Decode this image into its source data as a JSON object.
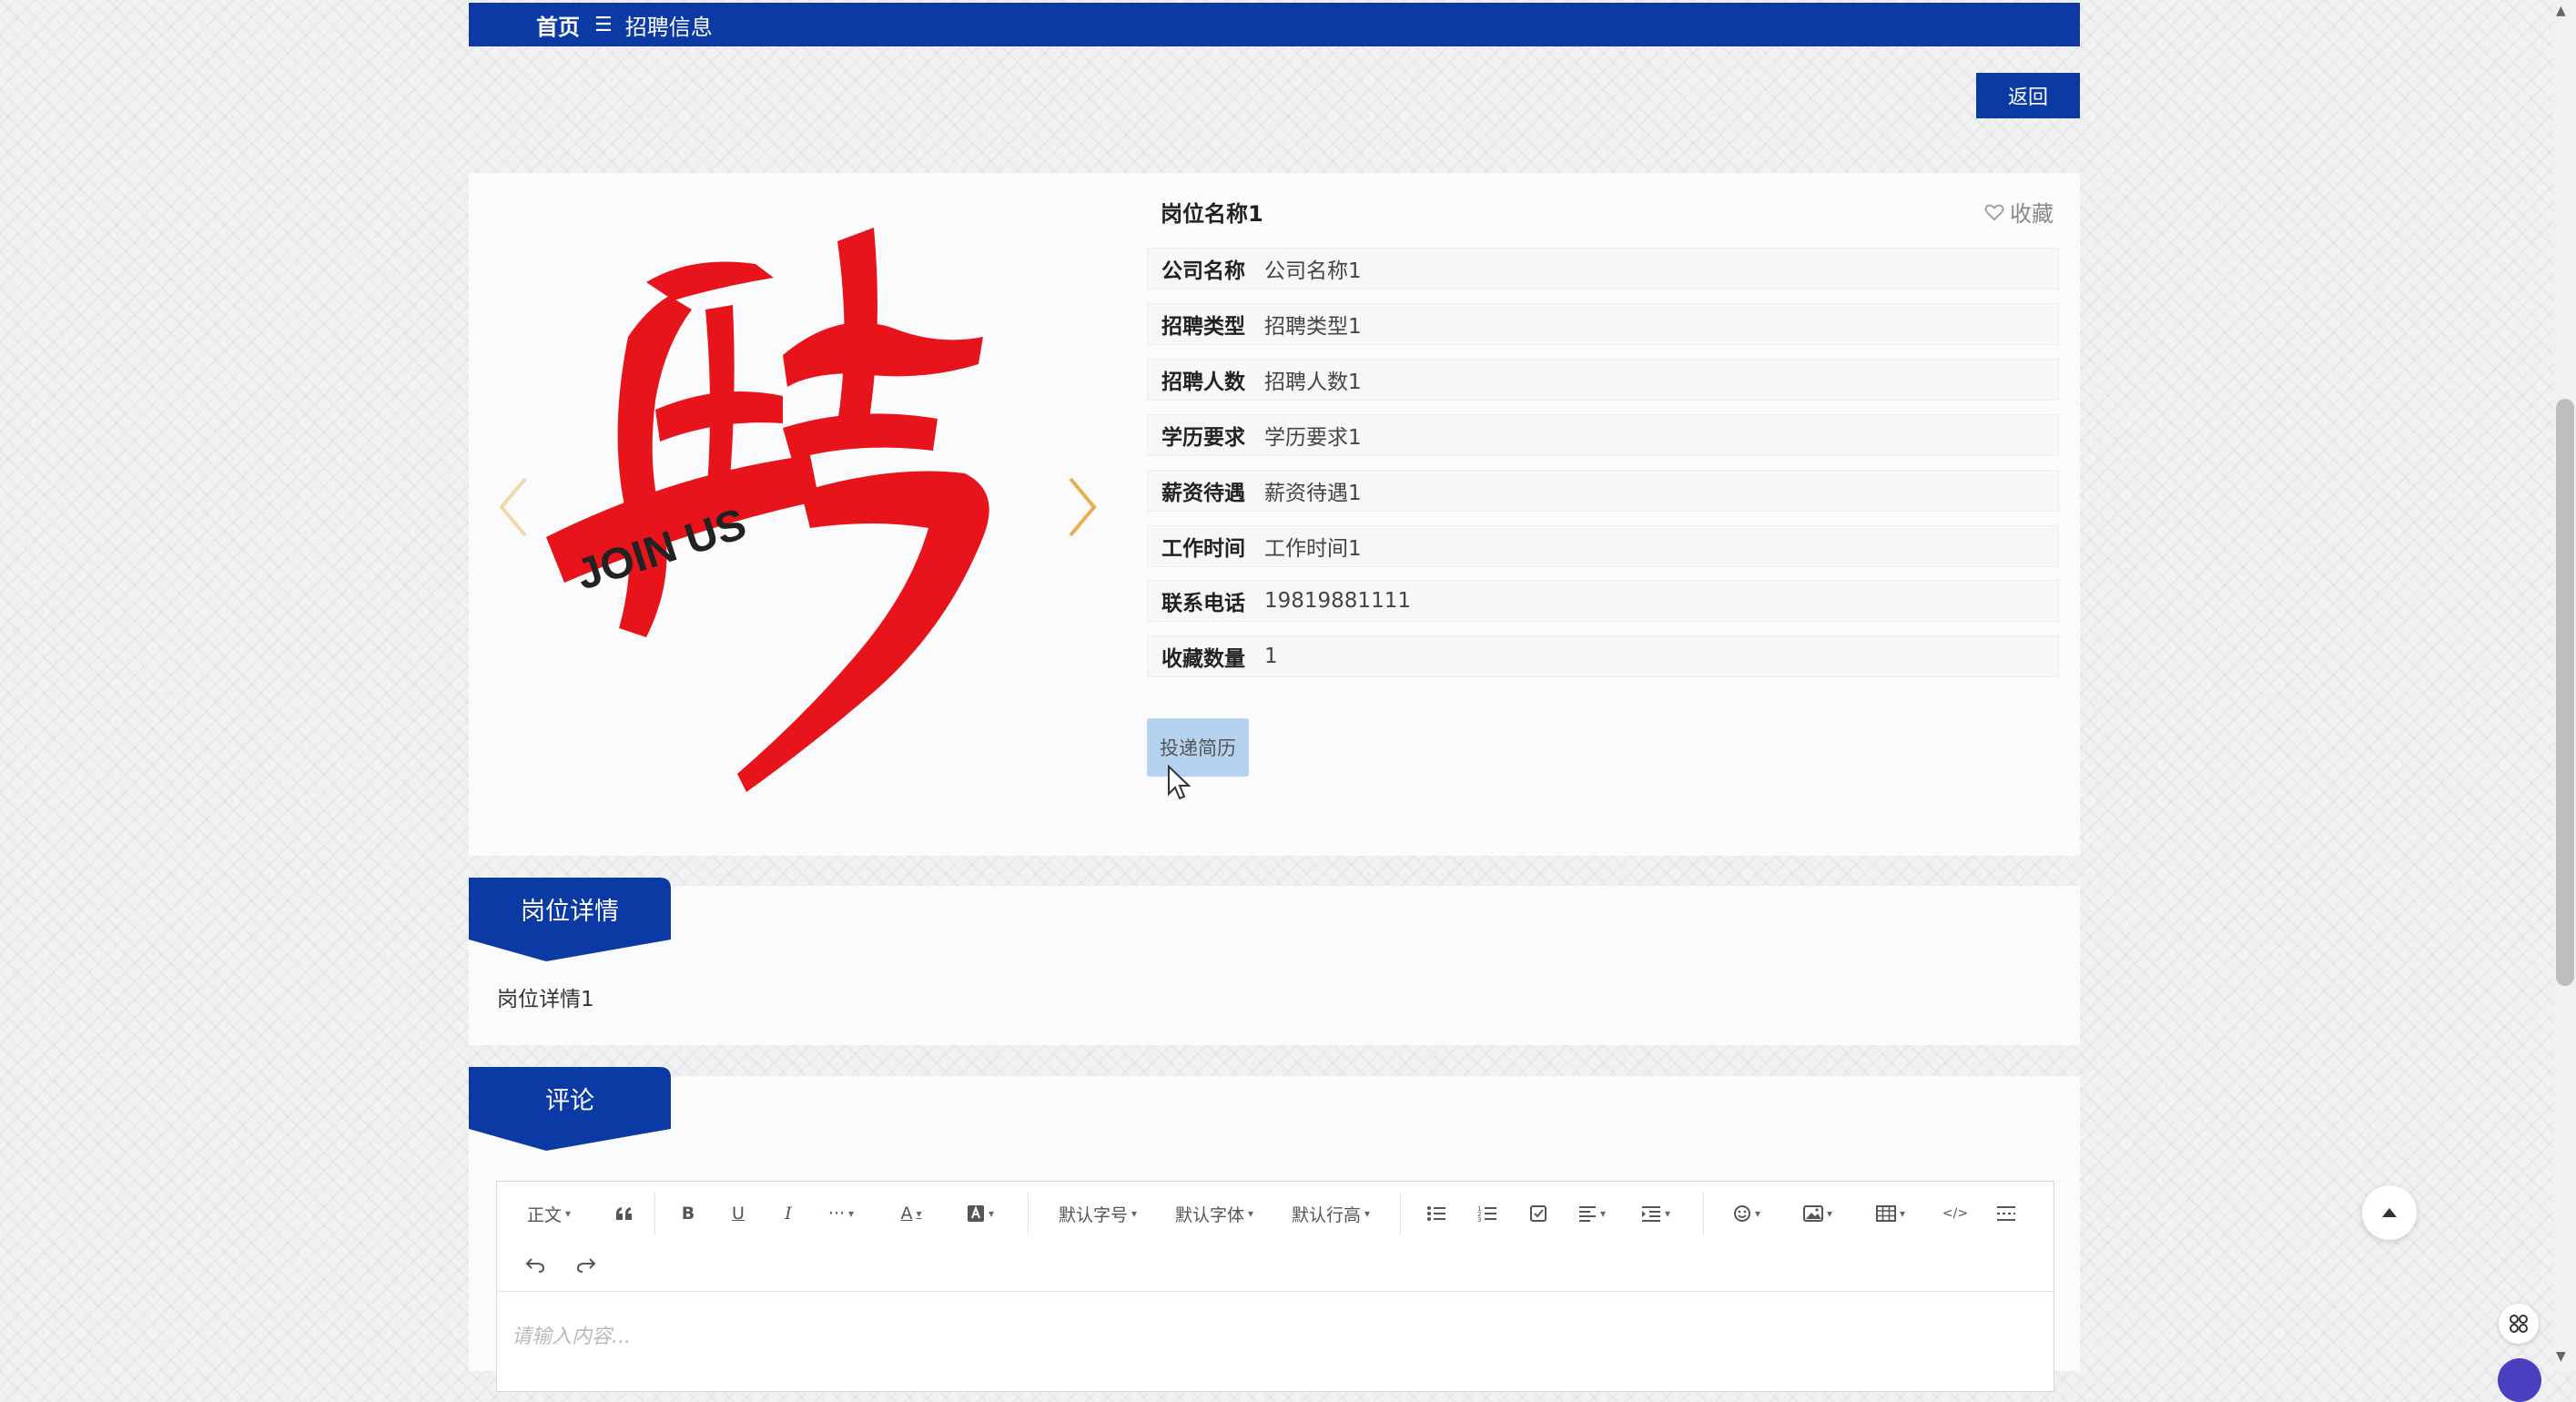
{
  "breadcrumb": {
    "home": "首页",
    "separator": "☰",
    "current": "招聘信息"
  },
  "back_button": "返回",
  "job": {
    "title": "岗位名称1",
    "favorite_label": "收藏",
    "carousel_image_text": "JOIN US",
    "fields": [
      {
        "label": "公司名称",
        "value": "公司名称1"
      },
      {
        "label": "招聘类型",
        "value": "招聘类型1"
      },
      {
        "label": "招聘人数",
        "value": "招聘人数1"
      },
      {
        "label": "学历要求",
        "value": "学历要求1"
      },
      {
        "label": "薪资待遇",
        "value": "薪资待遇1"
      },
      {
        "label": "工作时间",
        "value": "工作时间1"
      },
      {
        "label": "联系电话",
        "value": "19819881111"
      },
      {
        "label": "收藏数量",
        "value": "1"
      }
    ],
    "apply_button": "投递简历"
  },
  "details_section": {
    "heading": "岗位详情",
    "content": "岗位详情1"
  },
  "comment_section": {
    "heading": "评论",
    "editor": {
      "placeholder": "请输入内容...",
      "toolbar": {
        "paragraph": "正文",
        "font_size": "默认字号",
        "font_family": "默认字体",
        "line_height": "默认行高",
        "bold": "B",
        "underline": "U",
        "italic": "I",
        "more": "···",
        "font_color": "A",
        "code": "</>"
      }
    }
  },
  "colors": {
    "primary": "#0b3aa5",
    "apply_button": "#b5d3ee",
    "arrow": "#e8b04a",
    "brush": "#e8141b"
  }
}
